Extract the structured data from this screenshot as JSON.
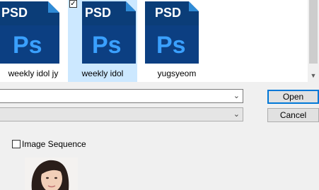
{
  "files": [
    {
      "icon_text": "PSD",
      "app_text": "Ps",
      "label": "weekly idol jy",
      "selected": false
    },
    {
      "icon_text": "PSD",
      "app_text": "Ps",
      "label": "weekly idol",
      "selected": true
    },
    {
      "icon_text": "PSD",
      "app_text": "Ps",
      "label": "yugsyeom",
      "selected": false
    }
  ],
  "file_name_value": "",
  "file_type_value": "",
  "buttons": {
    "open": "Open",
    "cancel": "Cancel"
  },
  "image_sequence": {
    "label": "Image Sequence",
    "checked": false
  },
  "colors": {
    "ps_dark": "#0b3d78",
    "ps_blue": "#2f8bd6",
    "ps_text": "#3aa0ff",
    "selection": "#cce8ff",
    "accent": "#0078d7"
  }
}
